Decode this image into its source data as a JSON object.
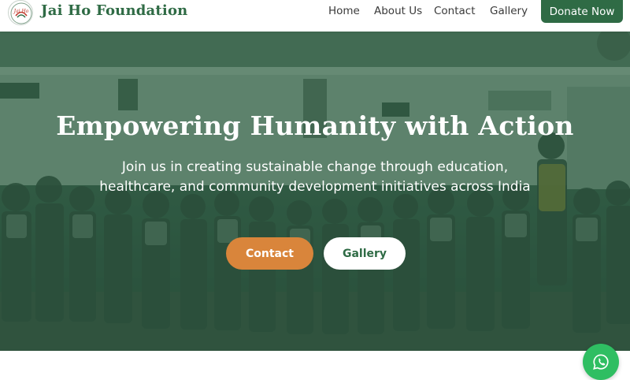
{
  "header": {
    "brand_name": "Jai Ho Foundation",
    "logo_text": "Jai Ho",
    "nav": [
      {
        "label": "Home"
      },
      {
        "label": "About Us"
      },
      {
        "label": "Contact"
      },
      {
        "label": "Gallery"
      }
    ],
    "donate_label": "Donate Now"
  },
  "hero": {
    "title": "Empowering Humanity with Action",
    "subtitle": "Join us in creating sustainable change through education, healthcare, and community development initiatives across India",
    "primary_button": "Contact",
    "secondary_button": "Gallery",
    "background_icon": "school-children-photo"
  },
  "floating": {
    "whatsapp_icon": "whatsapp-icon"
  },
  "colors": {
    "brand_green": "#2f6b45",
    "accent_orange": "#d9853b",
    "whatsapp_green": "#2fbe62"
  }
}
